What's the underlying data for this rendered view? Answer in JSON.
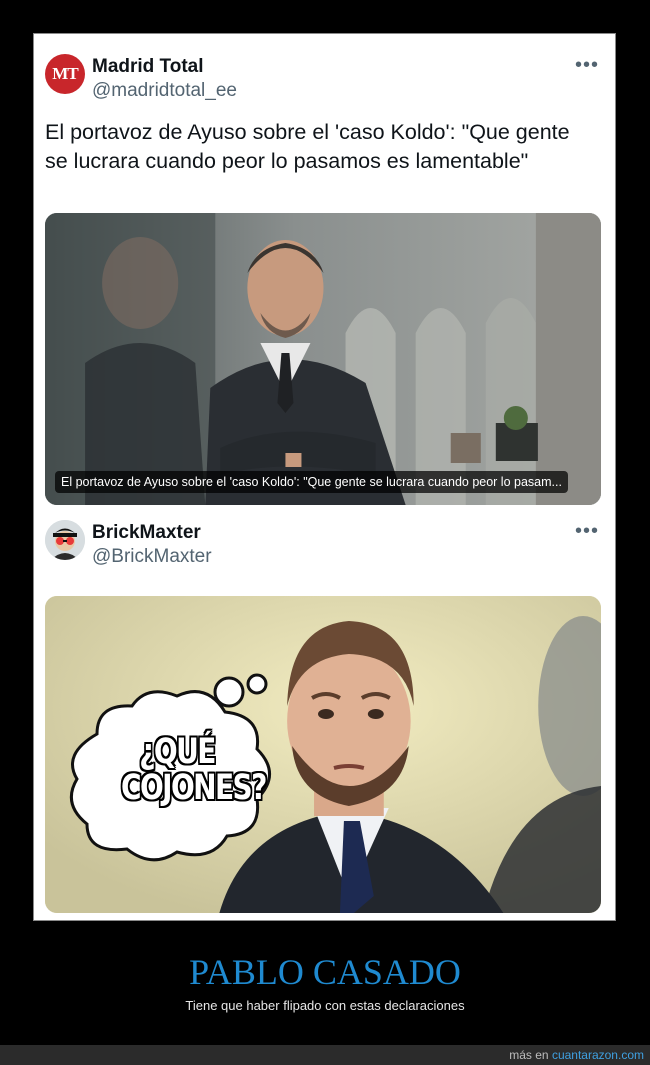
{
  "tweets": [
    {
      "avatar_text": "MT",
      "name": "Madrid Total",
      "handle": "@madridtotal_ee",
      "more": "•••",
      "text": "El portavoz de Ayuso sobre el 'caso Koldo': \"Que gente se lucrara cuando peor lo pasamos es lamentable\"",
      "media_caption": "El portavoz de Ayuso sobre el 'caso Koldo': \"Que gente se lucrara cuando peor lo pasam..."
    },
    {
      "name": "BrickMaxter",
      "handle": "@BrickMaxter",
      "more": "•••",
      "speech_line1": "¿QUÉ",
      "speech_line2": "COJONES?"
    }
  ],
  "post": {
    "title": "PABLO CASADO",
    "subtitle": "Tiene que haber flipado con estas declaraciones"
  },
  "footer": {
    "prefix": "más en",
    "link": "cuantarazon.com"
  },
  "colors": {
    "title": "#1f8ad0",
    "link": "#3fa0e0",
    "avatar_mt": "#c8262b"
  }
}
